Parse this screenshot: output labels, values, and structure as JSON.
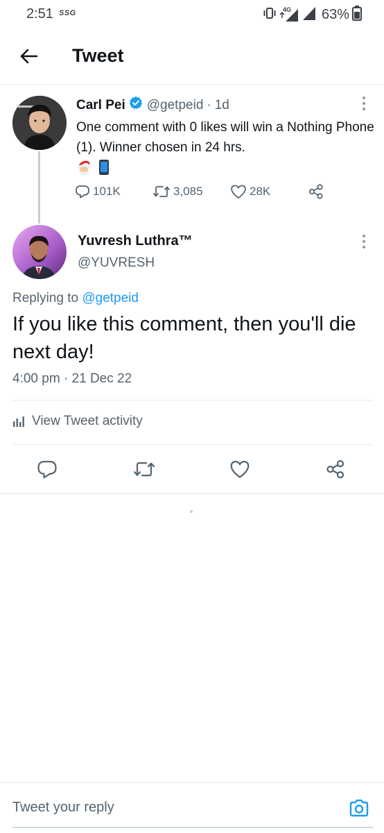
{
  "status_bar": {
    "time": "2:51",
    "carrier_icon": "SSG",
    "network": "4G",
    "battery": "63%"
  },
  "header": {
    "title": "Tweet"
  },
  "parent_tweet": {
    "name": "Carl Pei",
    "handle": "@getpeid",
    "separator": "·",
    "age": "1d",
    "text": "One comment with 0 likes will win a Nothing Phone (1). Winner chosen in 24 hrs.",
    "emojis": [
      "santa-emoji",
      "phone-emoji"
    ],
    "replies": "101K",
    "retweets": "3,085",
    "likes": "28K"
  },
  "main_tweet": {
    "name": "Yuvresh Luthra™",
    "handle": "@YUVRESH",
    "replying_prefix": "Replying to",
    "replying_to": "@getpeid",
    "text": "If you like this comment, then you'll die next day!",
    "timestamp": "4:00 pm · 21 Dec 22",
    "activity_label": "View Tweet activity"
  },
  "reply_bar": {
    "placeholder": "Tweet your reply"
  },
  "colors": {
    "accent": "#1d9bf0",
    "text_primary": "#0f1419",
    "text_secondary": "#536471",
    "divider": "#e6e9eb"
  }
}
